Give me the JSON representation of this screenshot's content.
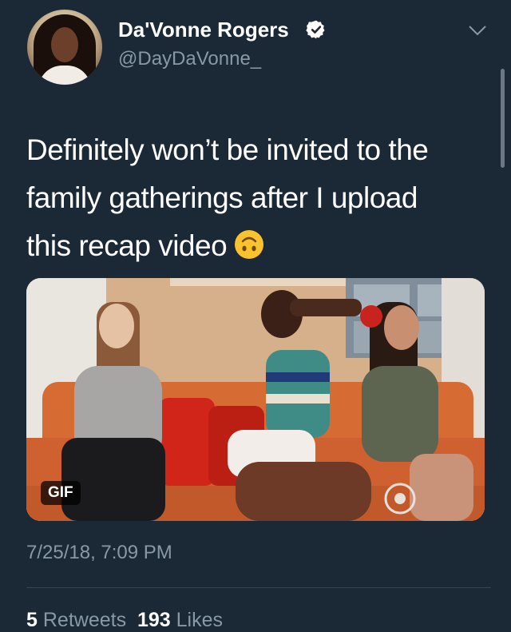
{
  "tweet": {
    "author": {
      "display_name": "Da'Vonne Rogers",
      "handle": "@DayDaVonne_",
      "verified": true
    },
    "text_lines": [
      "Definitely won’t be invited to the",
      "family gatherings after I upload",
      "this recap video"
    ],
    "emoji": "upside-down-face",
    "media": {
      "type": "gif",
      "badge": "GIF"
    },
    "timestamp": "7/25/18, 7:09 PM",
    "stats": {
      "retweets_count": "5",
      "retweets_label": "Retweets",
      "likes_count": "193",
      "likes_label": "Likes"
    }
  },
  "colors": {
    "background": "#1b2836",
    "secondary_text": "#8899a6",
    "verified_badge": "#ffffff",
    "emoji_yellow": "#f9c22e"
  }
}
